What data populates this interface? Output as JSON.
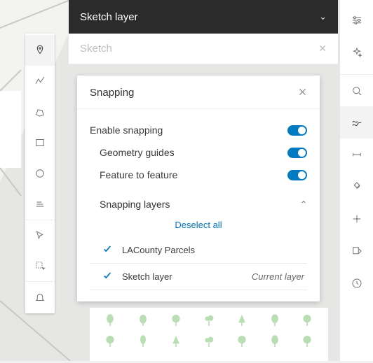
{
  "header": {
    "title": "Sketch layer"
  },
  "subheader": {
    "title": "Sketch"
  },
  "popup": {
    "title": "Snapping",
    "settings": {
      "enable_label": "Enable snapping",
      "geometry_label": "Geometry guides",
      "feature_label": "Feature to feature"
    },
    "layers_section": {
      "title": "Snapping layers",
      "deselect": "Deselect all",
      "items": [
        {
          "name": "LACounty Parcels",
          "tag": ""
        },
        {
          "name": "Sketch layer",
          "tag": "Current layer"
        }
      ]
    }
  }
}
